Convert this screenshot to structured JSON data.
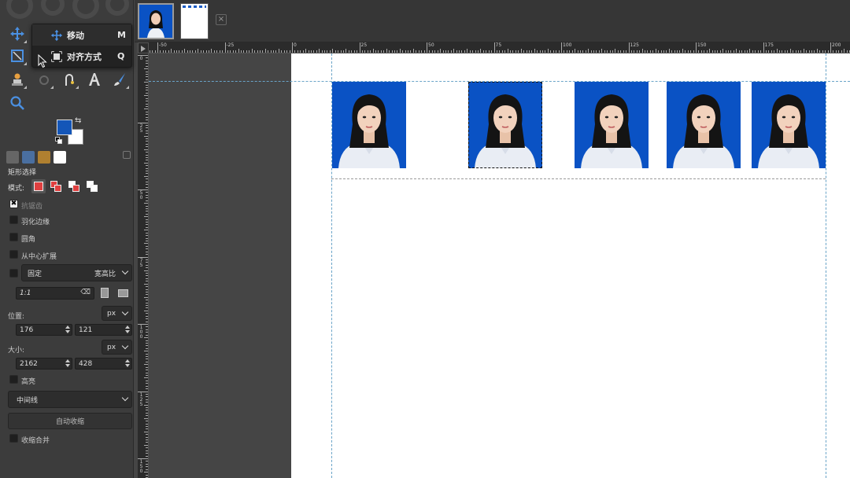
{
  "tool_menu": {
    "items": [
      {
        "label": "移动",
        "shortcut": "M",
        "icon": "move-icon"
      },
      {
        "label": "对齐方式",
        "shortcut": "Q",
        "icon": "align-icon"
      }
    ]
  },
  "colors": {
    "foreground": "#1456b8",
    "background": "#ffffff",
    "photo_bg": "#0a52c4",
    "guide": "#6aa4c8"
  },
  "tool_options": {
    "title": "矩形选择",
    "mode_label": "模式:",
    "antialias_label": "抗锯齿",
    "feather_label": "羽化边缘",
    "rounded_label": "圆角",
    "expand_center_label": "从中心扩展",
    "fixed_label": "固定",
    "fixed_mode": "宽高比",
    "ratio_value": "1:1",
    "position_label": "位置:",
    "position_unit": "px",
    "position_x": "176",
    "position_y": "121",
    "size_label": "大小:",
    "size_unit": "px",
    "size_w": "2162",
    "size_h": "428",
    "highlight_label": "高亮",
    "guides_value": "中间线",
    "auto_shrink_label": "自动收缩",
    "shrink_merged_label": "收缩合并"
  },
  "hruler": {
    "labels": [
      "-50",
      "-25",
      "0",
      "25",
      "50",
      "75",
      "100",
      "125",
      "150",
      "175",
      "200"
    ]
  },
  "vruler": {
    "labels": [
      "0",
      "25",
      "50",
      "75",
      "100",
      "125",
      "150"
    ]
  },
  "close_symbol": "×"
}
